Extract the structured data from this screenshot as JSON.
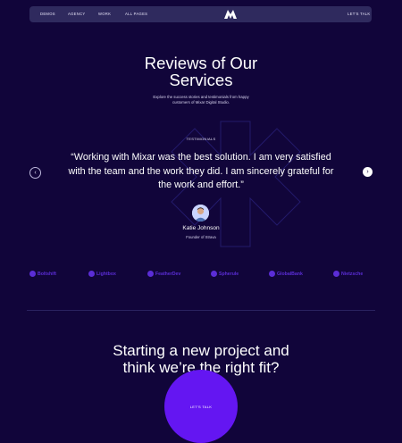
{
  "colors": {
    "background": "#11053a",
    "nav_background": "#2f2a5e",
    "accent": "#6416f2",
    "brand_logo": "#5b2dd6",
    "decor_line": "#231a6b"
  },
  "nav": {
    "links": [
      "DEMOS",
      "AGENCY",
      "WORK",
      "ALL PAGES"
    ],
    "logo_icon": "mixar-logo-icon",
    "cta": "LET'S TALK"
  },
  "hero": {
    "title_line1": "Reviews of Our",
    "title_line2": "Services",
    "subtitle_line1": "Explore the success stories and testimonials from happy",
    "subtitle_line2": "customers of Mixar Digital Studio."
  },
  "testimonials": {
    "label": "TESTIMONIALS",
    "quote": "“Working with Mixar was the best solution. I am very satisfied with the team and the work they did. I am sincerely grateful for the work and effort.”",
    "prev_icon": "chevron-left-icon",
    "next_icon": "chevron-right-icon",
    "person": {
      "name": "Katie Johnson",
      "role": "Founder of Strava"
    }
  },
  "brands": [
    "Boltshift",
    "Lightbox",
    "FeatherDev",
    "Spherule",
    "GlobalBank",
    "Nietzsche"
  ],
  "cta": {
    "title_line1": "Starting a new project and",
    "title_line2": "think we’re the right fit?",
    "button": "LET'S TALK"
  }
}
